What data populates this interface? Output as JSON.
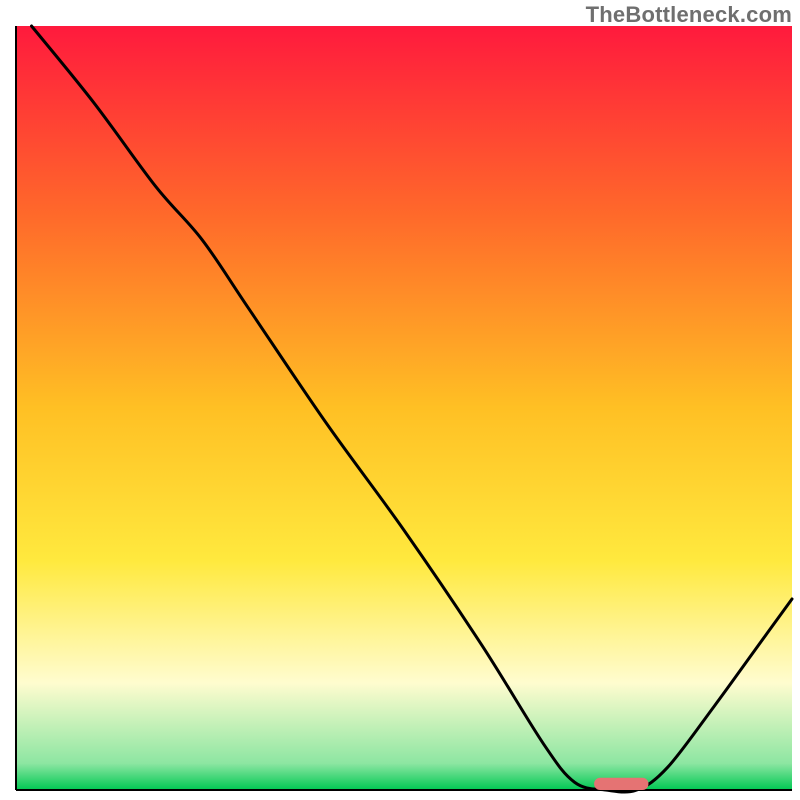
{
  "watermark": "TheBottleneck.com",
  "chart_data": {
    "type": "line",
    "title": "",
    "xlabel": "",
    "ylabel": "",
    "xlim": [
      0,
      100
    ],
    "ylim": [
      0,
      100
    ],
    "grid": false,
    "legend": false,
    "background_gradient": {
      "stops": [
        {
          "offset": 0.0,
          "color": "#ff1a3d"
        },
        {
          "offset": 0.25,
          "color": "#ff6a2a"
        },
        {
          "offset": 0.5,
          "color": "#ffc024"
        },
        {
          "offset": 0.7,
          "color": "#ffe93e"
        },
        {
          "offset": 0.86,
          "color": "#fffccf"
        },
        {
          "offset": 0.965,
          "color": "#8de6a2"
        },
        {
          "offset": 1.0,
          "color": "#00c853"
        }
      ]
    },
    "series": [
      {
        "name": "bottleneck-curve",
        "color": "#000000",
        "points": [
          {
            "x": 2.0,
            "y": 100.0
          },
          {
            "x": 10.0,
            "y": 90.0
          },
          {
            "x": 18.0,
            "y": 79.0
          },
          {
            "x": 24.0,
            "y": 72.0
          },
          {
            "x": 30.0,
            "y": 63.0
          },
          {
            "x": 40.0,
            "y": 48.0
          },
          {
            "x": 50.0,
            "y": 34.0
          },
          {
            "x": 60.0,
            "y": 19.0
          },
          {
            "x": 68.0,
            "y": 6.0
          },
          {
            "x": 72.0,
            "y": 1.0
          },
          {
            "x": 76.0,
            "y": 0.0
          },
          {
            "x": 80.0,
            "y": 0.0
          },
          {
            "x": 84.0,
            "y": 3.0
          },
          {
            "x": 90.0,
            "y": 11.0
          },
          {
            "x": 95.0,
            "y": 18.0
          },
          {
            "x": 100.0,
            "y": 25.0
          }
        ]
      }
    ],
    "marker": {
      "name": "optimal-range",
      "color": "#e57373",
      "x_start": 74.5,
      "x_end": 81.5,
      "y": 0.8,
      "height": 1.6
    },
    "axes": {
      "color": "#000000",
      "width": 2
    }
  }
}
